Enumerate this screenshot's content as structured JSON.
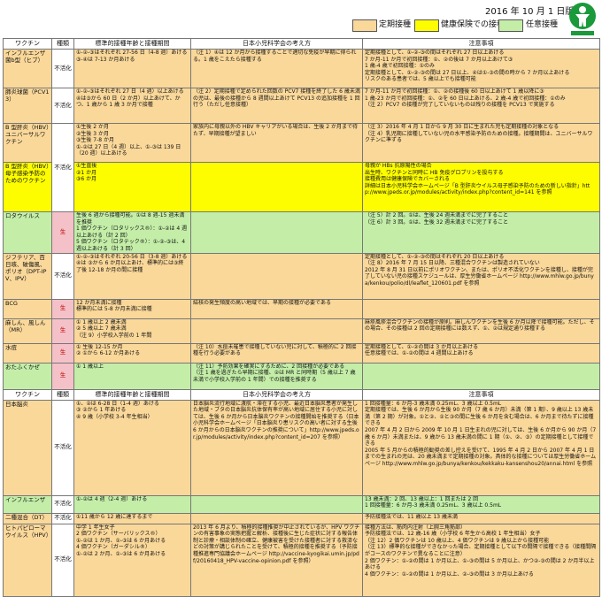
{
  "header": {
    "date": "2016 年 10 月 1 日版",
    "legend": [
      {
        "label": "定期接種",
        "color": "#fad89a"
      },
      {
        "label": "健康保険での接種",
        "color": "#fdfd00"
      },
      {
        "label": "任意接種",
        "color": "#c4eea8"
      }
    ],
    "logo_icon": "child-health-logo"
  },
  "cols": [
    "ワクチン",
    "種類",
    "標準的接種年齢と接種期間",
    "日本小児科学会の考え方",
    "注意事項"
  ],
  "rows": [
    {
      "name": "インフルエンザ菌b型（ヒブ）",
      "kind": "不活化",
      "age": [
        "①-②-③はそれぞれ 27-56 日（4-8 週）あける",
        "③-④は 7-13 か月あける"
      ],
      "view": [
        "（注 1）④は 12 か月から接種することで適切な免疫が早期に得られる。1 歳をこえたら接種する"
      ],
      "note": [
        "定期接種として、①-②-③の間はそれぞれ 27 日以上あける",
        "7 か月-11 か月で初回接種：①、②の後は 7 か月以上あけて③",
        "1 歳-4 歳で初回接種：①のみ",
        "定期接種として、①-②-③の間は 27 日以上、④は①-③の間の時から 7 か月以上あける",
        "リスクのある患者では、5 歳以上でも接種可能"
      ]
    },
    {
      "name": "肺炎球菌（PCV13）",
      "kind": "不活化",
      "age": [
        "①-②-③はそれぞれ 27 日（4 週）以上あける",
        "④は③から 60 日（2 か月）以上あけて、かつ、1 歳から 1 歳 3 か月で接種"
      ],
      "view": [
        "（注 2）定期接種で定められた回数の PCV7 接種を終了した 6 歳未満の児は、最後の接種から 8 週間以上あけて PCV13 の追加接種を 1 回行う（ただし任意接種）"
      ],
      "note": [
        "7 か月-11 か月で初回接種：①、②の接種後 60 日以上あけて 1 歳以降に③",
        "1 歳-23 か月で初回接種：①、②を 60 日以上あける、2 歳-4 歳で初回接種：①のみ",
        "（注 2）PCV7 の接種が完了していないものは残りの接種を PCV13 で実施する"
      ]
    },
    {
      "name": "B 型肝炎（HBV）ユニバーサルワクチン",
      "kind": "不活化",
      "age": [
        "①生後 2 か月",
        "②生後 3 か月",
        "③生後 7-8 か月",
        "①-②は 27 日（4 週）以上、①-③は 139 日（20 週）以上あける"
      ],
      "view": [
        "家族内に母親以外の HBV キャリアがいる場合は、生後 2 か月まで待たず、早期接種が望ましい"
      ],
      "note": [
        "（注 3）2016 年 4 月 1 日から 9 月 30 日に生まれた児も定期接種の対象となる",
        "（注 4）乳児期に接種していない児の水平感染予防のための接種。接種期間は、ユニバーサルワクチンに準ずる"
      ]
    },
    {
      "name": "B 型肝炎（HBV）母子感染予防のためのワクチン",
      "kind": "",
      "age": [
        "①生直後",
        "②1 か月",
        "③6 か月"
      ],
      "view": [
        ""
      ],
      "note": [
        "母親が HBs 抗原陽性の場合",
        "出生時、ワクチンと同時に HB 免疫グロブリンを投与する",
        "接種費用は健康保険でカバーされる",
        "詳細は日本小児科学会ホームページ「B 型肝炎ウイルス母子感染予防のための新しい指針」http://www.jpeds.or.jp/modules/activity/index.php?content_id=141 を参照"
      ]
    },
    {
      "name": "ロタウイルス",
      "kind": "生",
      "age": [
        "生後 6 週から接種可能。①は 8 週-15 週未満を推奨",
        "1 価ワクチン（ロタリックス®）：①-②は 4 週以上あける（計 2 回）",
        "5 価ワクチン（ロタテック®）：①-②-③は、4 週以上あける（計 3 回）"
      ],
      "view": [
        ""
      ],
      "note": [
        "（注 5）計 2 回。①は、生後 24 週未満までに完了すること",
        "（注 6）計 3 回。①は、生後 32 週未満までに完了すること"
      ]
    },
    {
      "name": "ジフテリア、百日咳、破傷風、ポリオ（DPT-IPV、IPV）",
      "kind": "不活化",
      "age": [
        "①-②-③はそれぞれ 20-56 日（3-8 週）あける",
        "④は ③から 6 か月以上あけ、標準的には③終了後 12-18 か月の間に接種"
      ],
      "view": [
        ""
      ],
      "note": [
        "定期接種として、①-②-③の間はそれぞれ 20 日以上あける",
        "（注 8）2016 年 7 月 15 日以降、三種混合ワクチンは製造されていない",
        "2012 年 8 月 31 日以前にポリオワクチン、または、ポリオ不活化ワクチンを接種し、接種が完了していない児の接種スケジュールは、厚生労働省ホームページ http://www.mhlw.go.jp/bunya/kenkou/polio/dl/leaflet_120601.pdf を参照"
      ]
    },
    {
      "name": "BCG",
      "kind": "生",
      "age": [
        "12 か月未満に接種",
        "標準的には 5-8 か月未満に接種"
      ],
      "view": [
        "結核の発生頻度の高い地域では、早期の接種が必要である"
      ],
      "note": [
        ""
      ]
    },
    {
      "name": "麻しん、風しん（MR）",
      "kind": "生",
      "age": [
        "① 1 歳以上 2 歳未満",
        "② 5 歳以上 7 歳未満",
        "（注 9）小学校入学前の 1 年間"
      ],
      "view": [
        ""
      ],
      "note": [
        "麻疹風疹混合ワクチンの接種が原則。麻しんワクチンを生後 6 か月以降で接種可能。ただし、その場合、その接種は 2 回の定期接種には数えず、①、②は規定通り接種する"
      ]
    },
    {
      "name": "水痘",
      "kind": "生",
      "age": [
        "① 生後 12-15 か月",
        "② ①から 6-12 か月あける"
      ],
      "view": [
        "（注 10）水痘未罹患で接種していない児に対して、積極的に 2 回接種を行う必要がある"
      ],
      "note": [
        "定期接種として、①-②の間は 3 か月以上あける",
        "任意接種では、①-②の間は 4 週間以上あける"
      ]
    },
    {
      "name": "おたふくかぜ",
      "kind": "生",
      "age": [
        "① 1 歳以上"
      ],
      "view": [
        "（注 11）予防効果を確実にするために、2 回接種が必要である",
        "（注 1 歳を過ぎたら早期に接種、②は MR と同時期（5 歳以上 7 歳未満で小学校入学前の 1 年間）での接種を推奨する"
      ],
      "note": [
        ""
      ]
    }
  ],
  "cols2": [
    "ワクチン",
    "種類",
    "標準的接種年齢と接種期間",
    "日本小児科学会の考え方",
    "注意事項"
  ],
  "rows2": [
    {
      "name": "日本脳炎",
      "kind": "不活化",
      "age": [
        "①、②は 6-28 日（1-4 週）あける",
        "③ ②から 1 年あける",
        "④ 9 歳（小学校 3-4 年生相当）"
      ],
      "view": [
        "日本脳炎流行地域に渡航・滞在する小児、最近日本脳炎患者が発生した地域・ブタの日本脳炎抗体保有率が高い地域に居住する小児に対しては、生後 6 か月から日本脳炎ワクチンの接種開始を推奨する（日本小児科学会ホームページ「日本脳炎り患リスクの高い者に対する生後 6 か月からの日本脳炎ワクチンの推奨について」http://www.jpeds.or.jp/modules/activity/index.php?content_id=207 を参照）"
      ],
      "note": [
        "1 回接種量：6 か月-3 歳未満 0.25mL、3 歳以上 0.5mL",
        "定期接種では、生後 6 か月から生後 90 か月（7 歳 6 か月）未満（第 1 期）、9 歳以上 13 歳未満（第 2 期）が対象。①と②、②と③の間に生後 6 か月を含む場合は、6 か月まで待たずに接種できる",
        "2007 年 4 月 2 日から 2009 年 10 月 1 日生まれの児に対しては、生後 6 か月から 90 か月（7 歳 6 か月）未満または、9 歳から 13 歳未満の間に 1 期（①、②、③）の定期接種として接種できる",
        "2005 年 5 月からの積極的勧奨の差し控えを受けて、1995 年 4 月 2 日から 2007 年 4 月 1 日までの生まれの児は、20 歳未満まで定期接種の対象。具体的な接種については厚生労働省ホームページ http://www.mhlw.go.jp/bunya/kenkou/kekkaku-kansenshou20/annai.html を参照"
      ]
    },
    {
      "name": "インフルエンザ",
      "kind": "不活化",
      "age": [
        "①-②は 4 週（2-4 週）あける"
      ],
      "view": [
        ""
      ],
      "note": [
        "13 歳未満：2 回、13 歳以上：1 回または 2 回",
        "1 回接種量：6 か月-3 歳未満 0.25mL、3 歳以上 0.5mL"
      ]
    },
    {
      "name": "二種混合（DT）",
      "kind": "不活化",
      "age": [
        "①11 歳から 12 歳に達するまで"
      ],
      "view": [
        ""
      ],
      "note": [
        "予防接種法では、11 歳以上 13 歳未満"
      ]
    },
    {
      "name": "ヒトパピローマウイルス（HPV）",
      "kind": "不活化",
      "age": [
        "中学 1 年生女子",
        "2 価ワクチン（サーバリックス®）",
        "①-②は 1 か月、①-③は 6 か月あける",
        "4 価ワクチン（ガーダシル®）",
        "①-②は 2 か月、①-③は 6 か月あける"
      ],
      "view": [
        "2013 年 6 月より、積極的接種推奨が中止されているが、HPV ワクチンの有害事象の実態把握と解析、接種後に生じた症状に対する報告体制と診療・相談体制の確立、健康被害を受けた接種者に対する救済などの対策が講じられたことを受けて、積極的接種を推奨する（予防接種推進専門協議会ホームページ http://vaccine-kyogikai.umin.jp/pdf/20160418_HPV-vaccine-opinion.pdf を参照）"
      ],
      "note": [
        "接種方法は、筋肉内注射（上腕三角筋部）",
        "予防接種法では、12 歳-16 歳（小学校 6 年生から高校 1 年生相当）女子",
        "（注 12）2 価ワクチンは 10 歳以上、4 価ワクチンは 9 歳以上から接種可能",
        "（注 13）標準的な接種ができなかった場合、定期接種として以下の間隔で接種できる（接種間隔がコースのワクチンで異なることに注意）",
        "2 価ワクチン：①-②の間は 1 か月以上、①-③の間は 5 か月以上、かつ②-③の間は 2 か月半以上あける",
        "4 価ワクチン：①-②の間は 1 か月以上、②-③の間は 3 か月以上あける"
      ]
    }
  ]
}
